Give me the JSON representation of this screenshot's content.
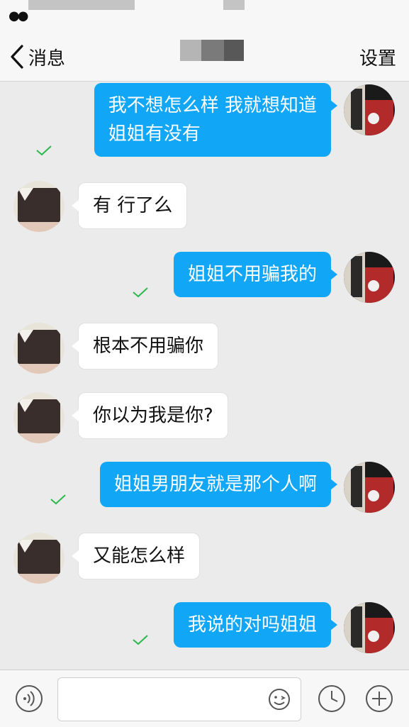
{
  "nav": {
    "back_label": "消息",
    "settings_label": "设置"
  },
  "messages": [
    {
      "side": "out",
      "lines": [
        "我不想怎么样 我就想知道",
        "姐姐有没有"
      ],
      "read": true
    },
    {
      "side": "in",
      "lines": [
        "有 行了么"
      ]
    },
    {
      "side": "out",
      "lines": [
        "姐姐不用骗我的"
      ],
      "read": true
    },
    {
      "side": "in",
      "lines": [
        "根本不用骗你"
      ]
    },
    {
      "side": "in",
      "lines": [
        "你以为我是你?"
      ]
    },
    {
      "side": "out",
      "lines": [
        "姐姐男朋友就是那个人啊"
      ],
      "read": true
    },
    {
      "side": "in",
      "lines": [
        "又能怎么样"
      ]
    },
    {
      "side": "out",
      "lines": [
        "我说的对吗姐姐"
      ],
      "read": true
    }
  ],
  "colors": {
    "bubble_out": "#12a6f6",
    "bubble_in": "#ffffff",
    "read_check": "#2db84d",
    "background": "#ebebeb"
  },
  "icons": {
    "back": "chevron-left-icon",
    "voice": "voice-icon",
    "emoji": "emoji-icon",
    "history": "clock-icon",
    "more": "plus-icon",
    "read": "check-icon"
  }
}
